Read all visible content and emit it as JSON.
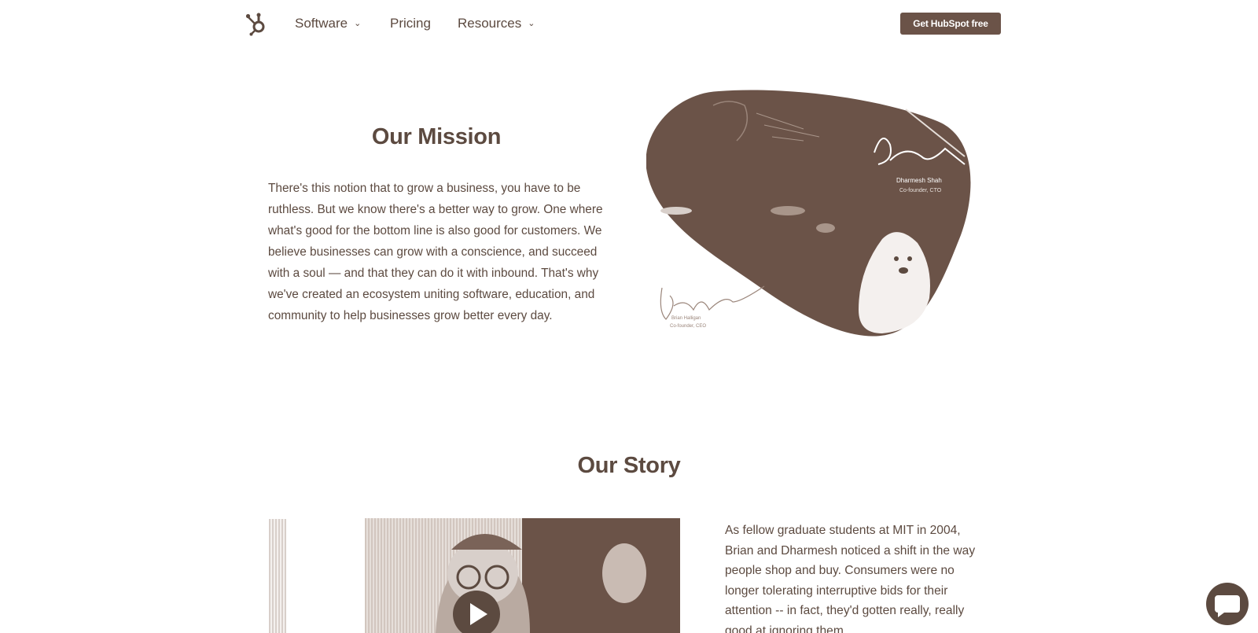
{
  "nav": {
    "items": [
      {
        "label": "Software",
        "has_dropdown": true
      },
      {
        "label": "Pricing",
        "has_dropdown": false
      },
      {
        "label": "Resources",
        "has_dropdown": true
      }
    ],
    "cta_label": "Get HubSpot free",
    "chevron": "⌄"
  },
  "mission": {
    "title": "Our Mission",
    "body": "There's this notion that to grow a business, you have to be ruthless. But we know there's a better way to grow. One where what's good for the bottom line is also good for customers. We believe businesses can grow with a conscience, and succeed with a soul — and that they can do it with inbound. That's why we've created an ecosystem uniting software, education, and community to help businesses grow better every day.",
    "image_caption_1": "Dharmesh Shah",
    "image_caption_2": "Co-founder, CTO",
    "image_caption_3": "Brian Halligan",
    "image_caption_4": "Co-founder, CEO"
  },
  "story": {
    "title": "Our Story",
    "body": "As fellow graduate students at MIT in 2004, Brian and Dharmesh noticed a shift in the way people shop and buy. Consumers were no longer tolerating interruptive bids for their attention -- in fact, they'd gotten really, really good at ignoring them."
  },
  "colors": {
    "brand": "#6b5348",
    "text": "#5c4a40",
    "background": "#ffffff"
  },
  "icons": {
    "logo": "hubspot-sprocket-icon",
    "play": "play-icon",
    "chat": "chat-bubble-icon"
  }
}
